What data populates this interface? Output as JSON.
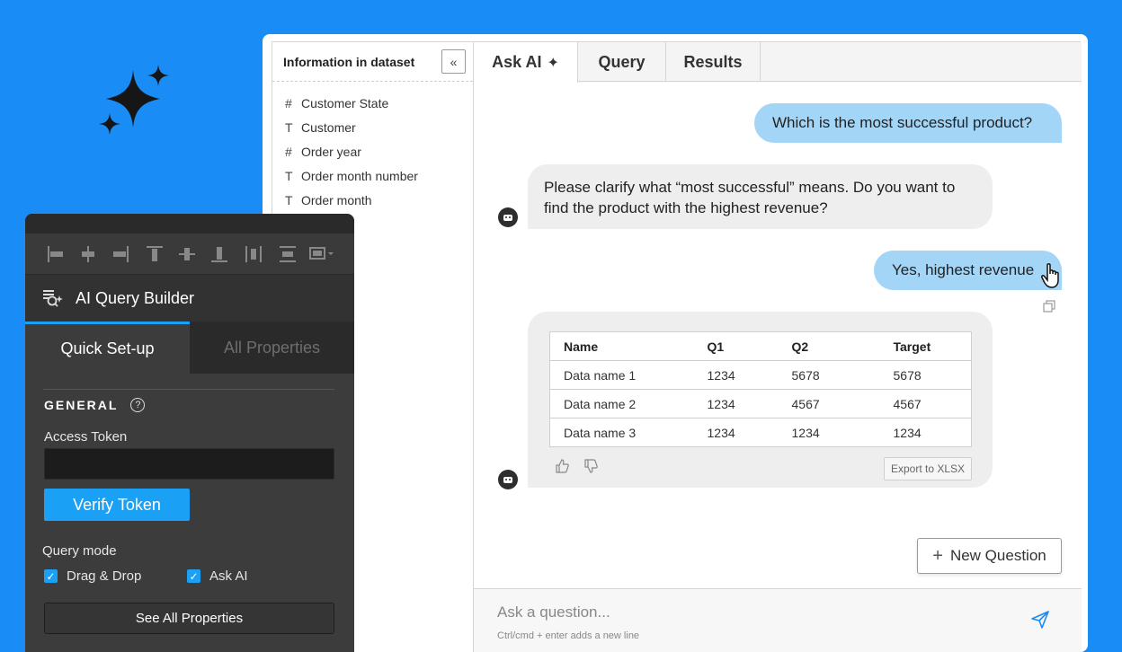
{
  "colors": {
    "background": "#1a8cf5",
    "accent": "#1aa0f5",
    "user_bubble": "#a3d5f7",
    "dark_panel": "#323232"
  },
  "dataset_panel": {
    "title": "Information in dataset",
    "fields": [
      {
        "type_icon": "#",
        "name": "Customer State"
      },
      {
        "type_icon": "T",
        "name": "Customer"
      },
      {
        "type_icon": "#",
        "name": "Order year"
      },
      {
        "type_icon": "T",
        "name": "Order month number"
      },
      {
        "type_icon": "T",
        "name": "Order month"
      }
    ]
  },
  "tabs": [
    {
      "label": "Ask AI",
      "active": true
    },
    {
      "label": "Query",
      "active": false
    },
    {
      "label": "Results",
      "active": false
    }
  ],
  "conversation": {
    "user_message_1": "Which is the most successful product?",
    "ai_message_1": "Please clarify what “most successful” means. Do you want to find the product with the highest revenue?",
    "user_message_2": "Yes, highest revenue",
    "result_table": {
      "headers": [
        "Name",
        "Q1",
        "Q2",
        "Target"
      ],
      "rows": [
        [
          "Data name 1",
          "1234",
          "5678",
          "5678"
        ],
        [
          "Data name 2",
          "1234",
          "4567",
          "4567"
        ],
        [
          "Data name 3",
          "1234",
          "1234",
          "1234"
        ]
      ]
    },
    "export_label": "Export to XLSX"
  },
  "new_question_label": "New Question",
  "input": {
    "placeholder": "Ask a question...",
    "hint": "Ctrl/cmd + enter adds a new line"
  },
  "builder": {
    "title": "AI Query Builder",
    "tabs": {
      "active": "Quick Set-up",
      "inactive": "All Properties"
    },
    "section_title": "GENERAL",
    "access_token_label": "Access Token",
    "verify_label": "Verify Token",
    "query_mode_label": "Query mode",
    "checkboxes": [
      {
        "label": "Drag & Drop",
        "checked": true
      },
      {
        "label": "Ask AI",
        "checked": true
      }
    ],
    "see_all_label": "See All Properties"
  }
}
